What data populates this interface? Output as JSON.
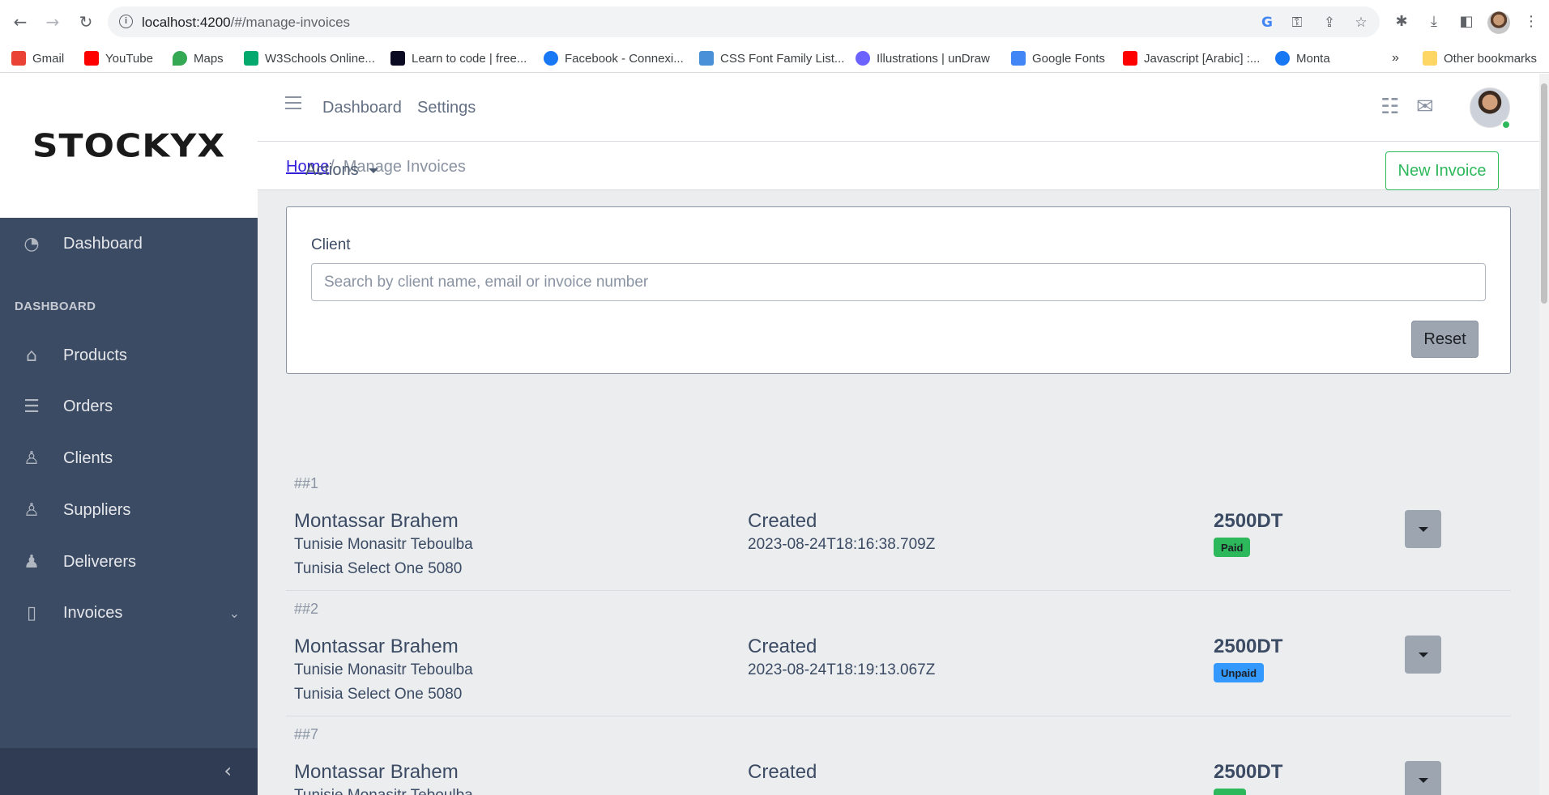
{
  "browser": {
    "url_host": "localhost:4200",
    "url_path": "/#/manage-invoices",
    "bookmarks": [
      {
        "label": "Gmail",
        "color": "#ea4335"
      },
      {
        "label": "YouTube",
        "color": "#ff0000"
      },
      {
        "label": "Maps",
        "color": "#34a853"
      },
      {
        "label": "W3Schools Online...",
        "color": "#04aa6d"
      },
      {
        "label": "Learn to code | free...",
        "color": "#0a0a23"
      },
      {
        "label": "Facebook - Connexi...",
        "color": "#1877f2"
      },
      {
        "label": "CSS Font Family List...",
        "color": "#4a90d9"
      },
      {
        "label": "Illustrations | unDraw",
        "color": "#6c63ff"
      },
      {
        "label": "Google Fonts",
        "color": "#4285f4"
      },
      {
        "label": "Javascript [Arabic] :...",
        "color": "#ff0000"
      },
      {
        "label": "Monta",
        "color": "#1877f2"
      }
    ],
    "more_bookmarks": "»",
    "other_bookmarks": "Other bookmarks"
  },
  "brand": {
    "name": "STOCKYX"
  },
  "sidebar": {
    "section_title": "DASHBOARD",
    "items": [
      {
        "label": "Dashboard",
        "icon": "speedometer-icon"
      },
      {
        "label": "Products",
        "icon": "basket-icon"
      },
      {
        "label": "Orders",
        "icon": "list-icon"
      },
      {
        "label": "Clients",
        "icon": "user-icon"
      },
      {
        "label": "Suppliers",
        "icon": "user-plus-icon"
      },
      {
        "label": "Deliverers",
        "icon": "people-icon"
      },
      {
        "label": "Invoices",
        "icon": "document-icon"
      }
    ]
  },
  "header": {
    "links": [
      "Dashboard",
      "Settings"
    ]
  },
  "breadcrumb": {
    "home": "Home",
    "separator": "/",
    "current": "Manage Invoices"
  },
  "toolbar": {
    "actions_label": "Actions",
    "new_invoice_label": "New Invoice"
  },
  "filter": {
    "label": "Client",
    "placeholder": "Search by client name, email or invoice number",
    "value": "",
    "reset_label": "Reset"
  },
  "invoices": [
    {
      "number": "##1",
      "client_name": "Montassar Brahem",
      "address_line1": "Tunisie Monasitr Teboulba",
      "address_line2": "Tunisia Select One 5080",
      "status_title": "Created",
      "date": "2023-08-24T18:16:38.709Z",
      "amount": "2500DT",
      "payment_status": "Paid"
    },
    {
      "number": "##2",
      "client_name": "Montassar Brahem",
      "address_line1": "Tunisie Monasitr Teboulba",
      "address_line2": "Tunisia Select One 5080",
      "status_title": "Created",
      "date": "2023-08-24T18:19:13.067Z",
      "amount": "2500DT",
      "payment_status": "Unpaid"
    },
    {
      "number": "##7",
      "client_name": "Montassar Brahem",
      "address_line1": "Tunisie Monasitr Teboulba",
      "address_line2": "",
      "status_title": "Created",
      "date": "",
      "amount": "2500DT",
      "payment_status": ""
    }
  ],
  "colors": {
    "sidebar_bg": "#3c4b64",
    "success": "#2eb85c",
    "info": "#3399ff",
    "primary_link": "#321fdb"
  }
}
